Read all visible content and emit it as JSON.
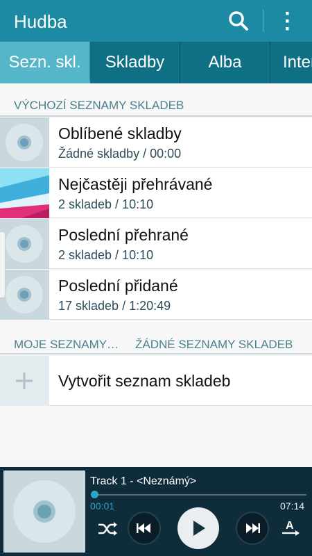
{
  "app": {
    "title": "Hudba"
  },
  "tabs": [
    {
      "label": "Sezn. skl."
    },
    {
      "label": "Skladby"
    },
    {
      "label": "Alba"
    },
    {
      "label": "Interpreti"
    }
  ],
  "default_section": {
    "header": "VÝCHOZÍ SEZNAMY SKLADEB"
  },
  "default_playlists": [
    {
      "title": "Oblíbené skladby",
      "subtitle": "Žádné skladby / 00:00"
    },
    {
      "title": "Nejčastěji přehrávané",
      "subtitle": "2 skladeb / 10:10"
    },
    {
      "title": "Poslední přehrané",
      "subtitle": "2 skladeb / 10:10"
    },
    {
      "title": "Poslední přidané",
      "subtitle": "17 skladeb / 1:20:49"
    }
  ],
  "my_section": {
    "header": "MOJE SEZNAMY…",
    "status": "ŽÁDNÉ SEZNAMY SKLADEB"
  },
  "create_playlist": {
    "label": "Vytvořit seznam skladeb"
  },
  "player": {
    "track": "Track 1 - <Neznámý>",
    "elapsed": "00:01",
    "total": "07:14",
    "progress": 0.002
  },
  "colors": {
    "appbar": "#1b8aa2",
    "tabbar": "#0f6f84",
    "tab_active": "#56b6c9",
    "accent": "#2ea3c9",
    "player_bg": "#0e2c3a"
  },
  "icons": [
    "search-icon",
    "more-vert-icon",
    "disc-icon",
    "plus-icon",
    "shuffle-icon",
    "previous-icon",
    "play-icon",
    "next-icon",
    "text-size-icon"
  ]
}
